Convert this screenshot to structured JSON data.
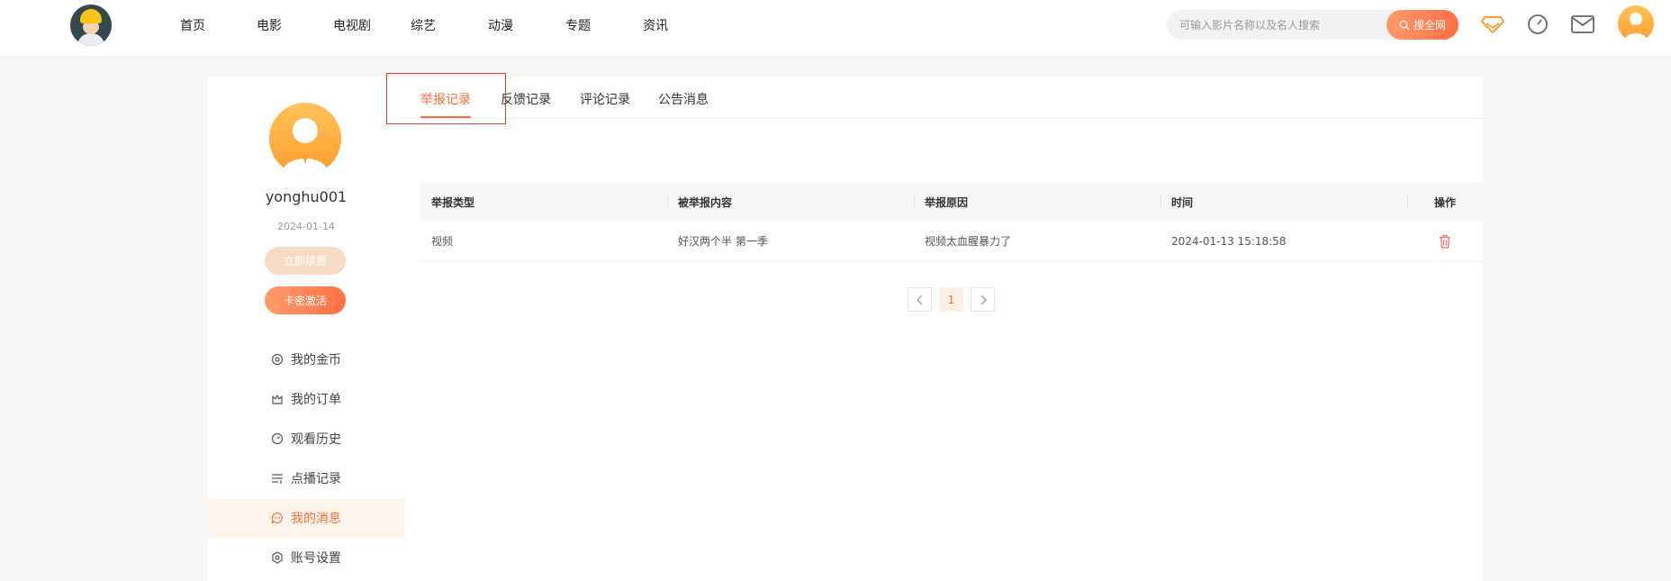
{
  "nav": {
    "items": [
      "首页",
      "电影",
      "电视剧",
      "综艺",
      "动漫",
      "专题",
      "资讯"
    ]
  },
  "search": {
    "placeholder": "可输入影片名称以及名人搜索",
    "button_label": "搜全网"
  },
  "header_icons": [
    "vip-diamond-icon",
    "history-clock-icon",
    "mail-icon",
    "user-avatar"
  ],
  "profile": {
    "username": "yonghu001",
    "date": "2024-01-14",
    "renew_label": "立即续费",
    "activate_label": "卡密激活"
  },
  "menu": [
    {
      "label": "我的金币",
      "icon": "coin-icon"
    },
    {
      "label": "我的订单",
      "icon": "order-icon"
    },
    {
      "label": "观看历史",
      "icon": "history-icon"
    },
    {
      "label": "点播记录",
      "icon": "playlist-icon"
    },
    {
      "label": "我的消息",
      "icon": "message-icon",
      "active": true
    },
    {
      "label": "账号设置",
      "icon": "settings-icon"
    }
  ],
  "tabs": [
    "举报记录",
    "反馈记录",
    "评论记录",
    "公告消息"
  ],
  "table": {
    "headers": [
      "举报类型",
      "被举报内容",
      "举报原因",
      "时间",
      "操作"
    ],
    "rows": [
      [
        "视频",
        "好汉两个半 第一季",
        "视频太血腥暴力了",
        "2024-01-13 15:18:58"
      ]
    ]
  },
  "pagination": {
    "current": "1"
  },
  "colors": {
    "accent": "#ff6b3d",
    "accent_light": "#fff5ec",
    "highlight_box": "#e53935"
  }
}
